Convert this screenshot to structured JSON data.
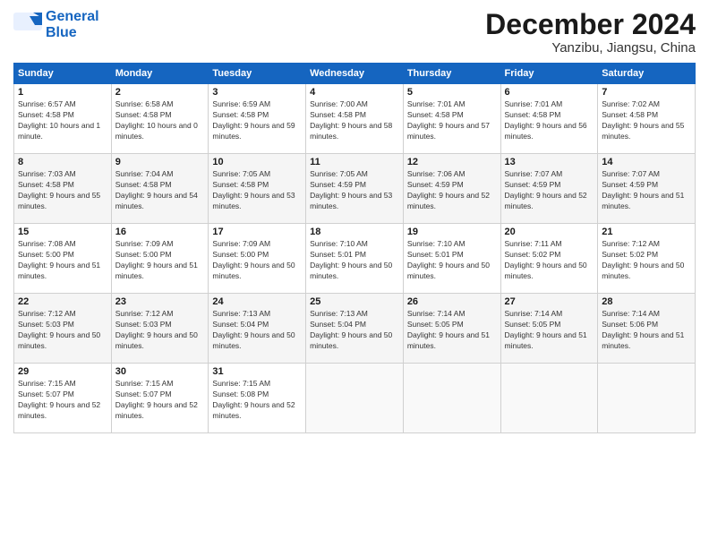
{
  "header": {
    "logo_line1": "General",
    "logo_line2": "Blue",
    "month": "December 2024",
    "location": "Yanzibu, Jiangsu, China"
  },
  "weekdays": [
    "Sunday",
    "Monday",
    "Tuesday",
    "Wednesday",
    "Thursday",
    "Friday",
    "Saturday"
  ],
  "weeks": [
    [
      {
        "day": 1,
        "sunrise": "6:57 AM",
        "sunset": "4:58 PM",
        "daylight": "10 hours and 1 minute."
      },
      {
        "day": 2,
        "sunrise": "6:58 AM",
        "sunset": "4:58 PM",
        "daylight": "10 hours and 0 minutes."
      },
      {
        "day": 3,
        "sunrise": "6:59 AM",
        "sunset": "4:58 PM",
        "daylight": "9 hours and 59 minutes."
      },
      {
        "day": 4,
        "sunrise": "7:00 AM",
        "sunset": "4:58 PM",
        "daylight": "9 hours and 58 minutes."
      },
      {
        "day": 5,
        "sunrise": "7:01 AM",
        "sunset": "4:58 PM",
        "daylight": "9 hours and 57 minutes."
      },
      {
        "day": 6,
        "sunrise": "7:01 AM",
        "sunset": "4:58 PM",
        "daylight": "9 hours and 56 minutes."
      },
      {
        "day": 7,
        "sunrise": "7:02 AM",
        "sunset": "4:58 PM",
        "daylight": "9 hours and 55 minutes."
      }
    ],
    [
      {
        "day": 8,
        "sunrise": "7:03 AM",
        "sunset": "4:58 PM",
        "daylight": "9 hours and 55 minutes."
      },
      {
        "day": 9,
        "sunrise": "7:04 AM",
        "sunset": "4:58 PM",
        "daylight": "9 hours and 54 minutes."
      },
      {
        "day": 10,
        "sunrise": "7:05 AM",
        "sunset": "4:58 PM",
        "daylight": "9 hours and 53 minutes."
      },
      {
        "day": 11,
        "sunrise": "7:05 AM",
        "sunset": "4:59 PM",
        "daylight": "9 hours and 53 minutes."
      },
      {
        "day": 12,
        "sunrise": "7:06 AM",
        "sunset": "4:59 PM",
        "daylight": "9 hours and 52 minutes."
      },
      {
        "day": 13,
        "sunrise": "7:07 AM",
        "sunset": "4:59 PM",
        "daylight": "9 hours and 52 minutes."
      },
      {
        "day": 14,
        "sunrise": "7:07 AM",
        "sunset": "4:59 PM",
        "daylight": "9 hours and 51 minutes."
      }
    ],
    [
      {
        "day": 15,
        "sunrise": "7:08 AM",
        "sunset": "5:00 PM",
        "daylight": "9 hours and 51 minutes."
      },
      {
        "day": 16,
        "sunrise": "7:09 AM",
        "sunset": "5:00 PM",
        "daylight": "9 hours and 51 minutes."
      },
      {
        "day": 17,
        "sunrise": "7:09 AM",
        "sunset": "5:00 PM",
        "daylight": "9 hours and 50 minutes."
      },
      {
        "day": 18,
        "sunrise": "7:10 AM",
        "sunset": "5:01 PM",
        "daylight": "9 hours and 50 minutes."
      },
      {
        "day": 19,
        "sunrise": "7:10 AM",
        "sunset": "5:01 PM",
        "daylight": "9 hours and 50 minutes."
      },
      {
        "day": 20,
        "sunrise": "7:11 AM",
        "sunset": "5:02 PM",
        "daylight": "9 hours and 50 minutes."
      },
      {
        "day": 21,
        "sunrise": "7:12 AM",
        "sunset": "5:02 PM",
        "daylight": "9 hours and 50 minutes."
      }
    ],
    [
      {
        "day": 22,
        "sunrise": "7:12 AM",
        "sunset": "5:03 PM",
        "daylight": "9 hours and 50 minutes."
      },
      {
        "day": 23,
        "sunrise": "7:12 AM",
        "sunset": "5:03 PM",
        "daylight": "9 hours and 50 minutes."
      },
      {
        "day": 24,
        "sunrise": "7:13 AM",
        "sunset": "5:04 PM",
        "daylight": "9 hours and 50 minutes."
      },
      {
        "day": 25,
        "sunrise": "7:13 AM",
        "sunset": "5:04 PM",
        "daylight": "9 hours and 50 minutes."
      },
      {
        "day": 26,
        "sunrise": "7:14 AM",
        "sunset": "5:05 PM",
        "daylight": "9 hours and 51 minutes."
      },
      {
        "day": 27,
        "sunrise": "7:14 AM",
        "sunset": "5:05 PM",
        "daylight": "9 hours and 51 minutes."
      },
      {
        "day": 28,
        "sunrise": "7:14 AM",
        "sunset": "5:06 PM",
        "daylight": "9 hours and 51 minutes."
      }
    ],
    [
      {
        "day": 29,
        "sunrise": "7:15 AM",
        "sunset": "5:07 PM",
        "daylight": "9 hours and 52 minutes."
      },
      {
        "day": 30,
        "sunrise": "7:15 AM",
        "sunset": "5:07 PM",
        "daylight": "9 hours and 52 minutes."
      },
      {
        "day": 31,
        "sunrise": "7:15 AM",
        "sunset": "5:08 PM",
        "daylight": "9 hours and 52 minutes."
      },
      null,
      null,
      null,
      null
    ]
  ]
}
